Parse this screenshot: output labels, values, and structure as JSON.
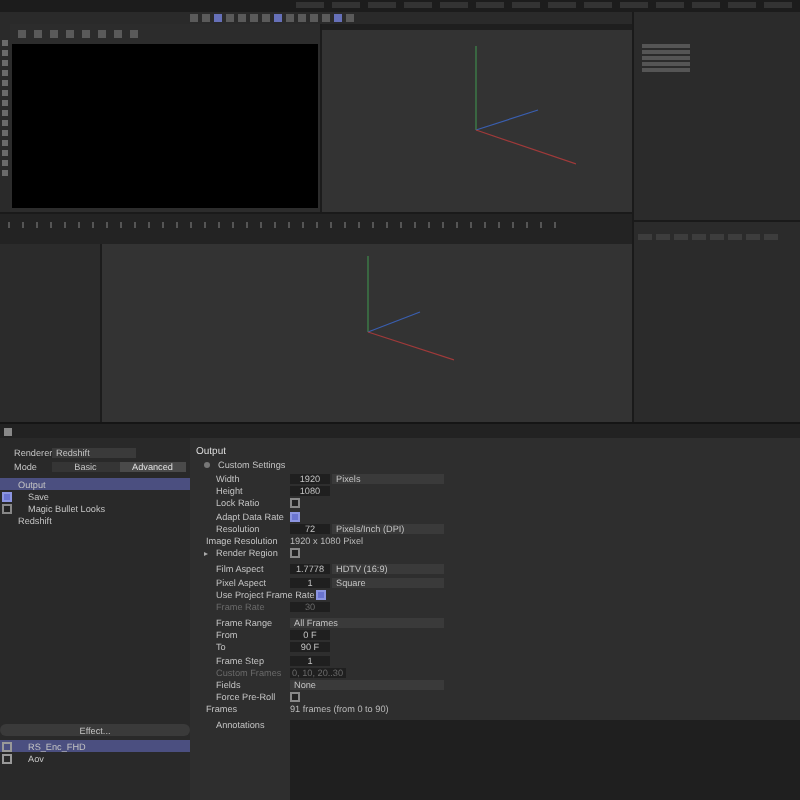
{
  "render_settings": {
    "renderer": {
      "label": "Renderer",
      "value": "Redshift"
    },
    "mode": {
      "label": "Mode",
      "tabs": [
        {
          "label": "Basic",
          "selected": false
        },
        {
          "label": "Advanced",
          "selected": true
        }
      ]
    },
    "items": [
      {
        "label": "Output",
        "kind": "plain",
        "selected": true
      },
      {
        "label": "Save",
        "kind": "check",
        "checked": true,
        "selected": false
      },
      {
        "label": "Magic Bullet Looks",
        "kind": "check",
        "checked": false,
        "selected": false
      },
      {
        "label": "Redshift",
        "kind": "plain",
        "selected": false
      }
    ],
    "effect_button": "Effect...",
    "presets": [
      {
        "label": "RS_Enc_FHD",
        "selected": true
      },
      {
        "label": "Aov",
        "selected": false
      }
    ],
    "panel": {
      "title": "Output",
      "custom_settings": "Custom Settings",
      "rows": [
        {
          "kind": "field",
          "label": "Width",
          "value": "1920",
          "dropdown": "Pixels"
        },
        {
          "kind": "field",
          "label": "Height",
          "value": "1080"
        },
        {
          "kind": "check",
          "label": "Lock Ratio",
          "checked": false
        },
        {
          "kind": "check",
          "label": "Adapt Data Rate",
          "checked": true
        },
        {
          "kind": "field",
          "label": "Resolution",
          "value": "72",
          "dropdown": "Pixels/Inch (DPI)"
        },
        {
          "kind": "info",
          "label": "Image Resolution",
          "value": "1920 x 1080 Pixel"
        },
        {
          "kind": "check",
          "label": "Render Region",
          "checked": false,
          "expandable": true
        },
        {
          "kind": "field",
          "label": "Film Aspect",
          "value": "1.7778",
          "dropdown": "HDTV (16:9)",
          "gap": true
        },
        {
          "kind": "field",
          "label": "Pixel Aspect",
          "value": "1",
          "dropdown": "Square"
        },
        {
          "kind": "check",
          "label": "Use Project Frame Rate",
          "checked": true
        },
        {
          "kind": "field",
          "label": "Frame Rate",
          "value": "30",
          "disabled": true
        },
        {
          "kind": "select",
          "label": "Frame Range",
          "value": "All Frames",
          "gap": true
        },
        {
          "kind": "field",
          "label": "From",
          "value": "0 F"
        },
        {
          "kind": "field",
          "label": "To",
          "value": "90 F"
        },
        {
          "kind": "field",
          "label": "Frame Step",
          "value": "1"
        },
        {
          "kind": "field",
          "label": "Custom Frames",
          "value": "0, 10, 20..30",
          "disabled": true
        },
        {
          "kind": "select",
          "label": "Fields",
          "value": "None"
        },
        {
          "kind": "check",
          "label": "Force Pre-Roll",
          "checked": false
        },
        {
          "kind": "info",
          "label": "Frames",
          "value": "91 frames (from 0 to 90)"
        },
        {
          "kind": "area",
          "label": "Annotations",
          "gap": true
        }
      ]
    }
  }
}
